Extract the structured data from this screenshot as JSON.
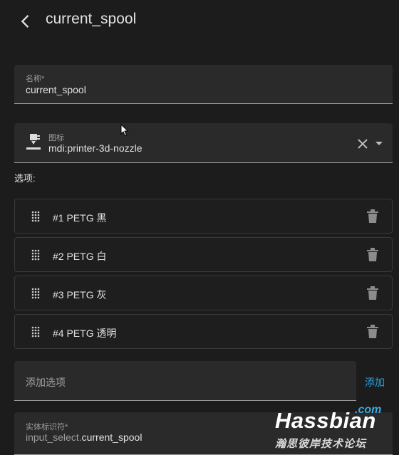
{
  "header": {
    "title": "current_spool",
    "back_icon": "chevron-left-icon"
  },
  "name_field": {
    "label": "名称*",
    "value": "current_spool"
  },
  "icon_field": {
    "label": "图标",
    "value": "mdi:printer-3d-nozzle",
    "icon": "printer-3d-nozzle-icon"
  },
  "options": {
    "label": "选项:",
    "items": [
      {
        "label": "#1 PETG 黑"
      },
      {
        "label": "#2 PETG 白"
      },
      {
        "label": "#3 PETG 灰"
      },
      {
        "label": "#4 PETG 透明"
      }
    ],
    "add_placeholder": "添加选项",
    "add_button": "添加"
  },
  "entity_field": {
    "label": "实体标识符*",
    "prefix": "input_select.",
    "value": "current_spool"
  },
  "watermark": {
    "name": "Hassbian",
    "domain": ".com",
    "sub": "瀚思彼岸技术论坛"
  },
  "colors": {
    "accent": "#2aa2dc",
    "background": "#1c1c1c",
    "field": "#2a2a2a"
  }
}
